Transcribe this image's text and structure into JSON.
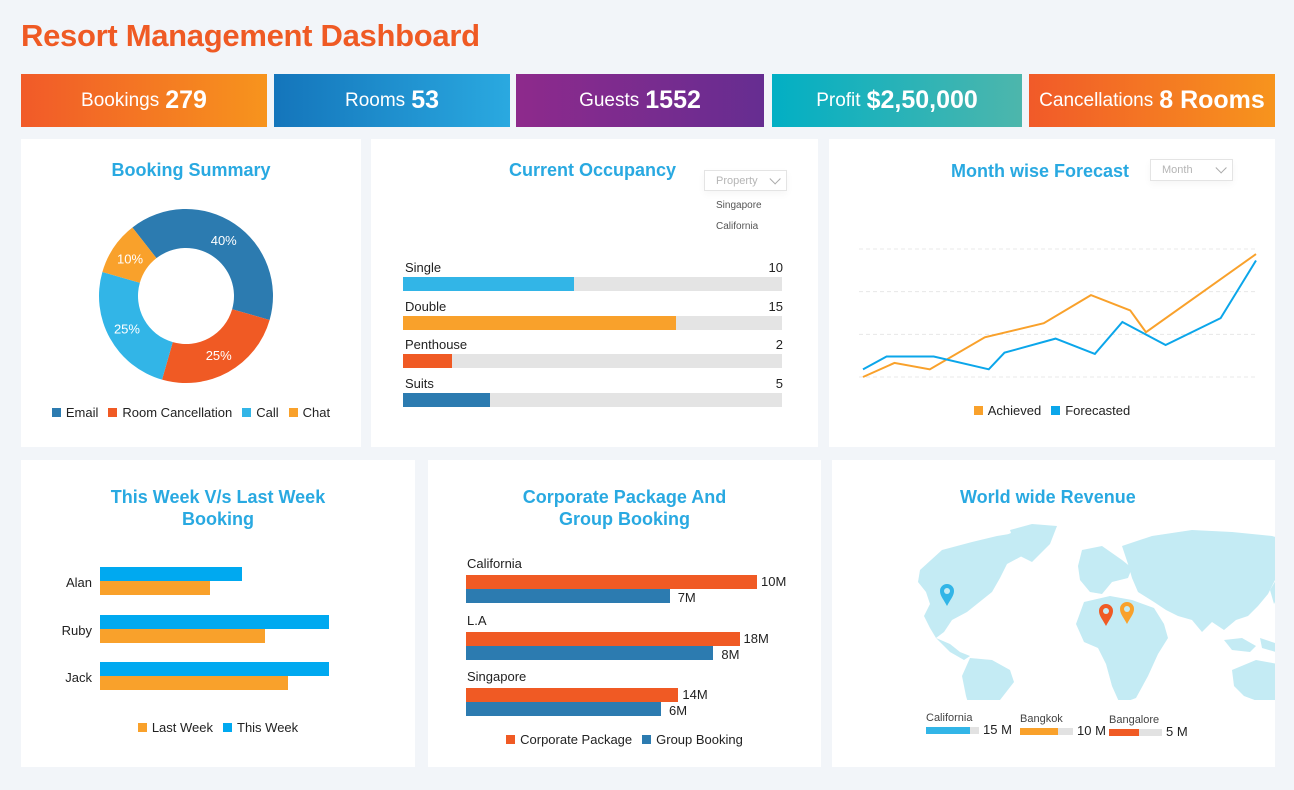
{
  "header": {
    "title": "Resort Management Dashboard"
  },
  "kpis": [
    {
      "label": "Bookings",
      "value": "279"
    },
    {
      "label": "Rooms",
      "value": "53"
    },
    {
      "label": "Guests",
      "value": "1552"
    },
    {
      "label": "Profit",
      "value": "$2,50,000"
    },
    {
      "label": "Cancellations",
      "value": "8 Rooms"
    }
  ],
  "colors": {
    "accent_title": "#ef5a24",
    "panel_title": "#29a9e1",
    "email": "#2c7bb0",
    "room_cancellation": "#f05a24",
    "call": "#32b5e7",
    "chat": "#f9a12b",
    "achieved": "#f9a12b",
    "forecasted": "#0ba6ea",
    "last_week": "#f9a12b",
    "this_week": "#00a9f0",
    "corporate": "#f05a24",
    "group": "#2c7bb0"
  },
  "booking_summary": {
    "title": "Booking Summary"
  },
  "occupancy": {
    "title": "Current Occupancy",
    "dropdown": {
      "placeholder": "Property",
      "options": [
        "Singapore",
        "California"
      ]
    }
  },
  "forecast": {
    "title": "Month wise Forecast",
    "dropdown": {
      "placeholder": "Month"
    }
  },
  "week": {
    "title_line1": "This Week V/s Last Week",
    "title_line2": "Booking"
  },
  "corporate": {
    "title_line1": "Corporate Package And",
    "title_line2": "Group Booking"
  },
  "revenue": {
    "title": "World wide Revenue",
    "items": [
      {
        "name": "California",
        "value": "15 M",
        "fill": 0.83,
        "color": "#32b5e7"
      },
      {
        "name": "Bangkok",
        "value": "10 M",
        "fill": 0.72,
        "color": "#f9a12b"
      },
      {
        "name": "Bangalore",
        "value": "5 M",
        "fill": 0.57,
        "color": "#f05a24"
      }
    ],
    "pins": [
      {
        "name": "California",
        "color": "#32b5e7"
      },
      {
        "name": "Bangalore",
        "color": "#f05a24"
      },
      {
        "name": "Bangkok",
        "color": "#f9a12b"
      }
    ]
  },
  "chart_data": [
    {
      "id": "booking-summary",
      "type": "pie",
      "title": "Booking Summary",
      "categories": [
        "Email",
        "Room Cancellation",
        "Call",
        "Chat"
      ],
      "values": [
        40,
        25,
        25,
        10
      ],
      "labels": [
        "40%",
        "25%",
        "25%",
        "10%"
      ],
      "donut": true,
      "legend": "bottom"
    },
    {
      "id": "current-occupancy",
      "type": "bar",
      "orientation": "horizontal",
      "title": "Current Occupancy",
      "categories": [
        "Single",
        "Double",
        "Penthouse",
        "Suits"
      ],
      "values": [
        10,
        15,
        2,
        5
      ],
      "fill_fraction": [
        0.45,
        0.72,
        0.13,
        0.23
      ],
      "colors": [
        "#32b5e7",
        "#f9a12b",
        "#f05a24",
        "#2c7bb0"
      ]
    },
    {
      "id": "month-forecast",
      "type": "line",
      "title": "Month wise Forecast",
      "x": [
        1,
        2,
        3,
        4,
        5,
        6,
        7,
        8,
        9,
        10,
        11,
        12
      ],
      "series": [
        {
          "name": "Achieved",
          "values": [
            0.0,
            1.1,
            0.6,
            3.1,
            4.2,
            6.4,
            5.2,
            3.5,
            null,
            null,
            null,
            9.6
          ]
        },
        {
          "name": "Forecasted",
          "values": [
            0.6,
            1.6,
            1.6,
            0.6,
            1.9,
            3.0,
            1.8,
            4.3,
            2.5,
            null,
            4.6,
            9.1
          ]
        }
      ],
      "points": {
        "Achieved": [
          [
            0,
            0.0
          ],
          [
            0.08,
            1.1
          ],
          [
            0.17,
            0.6
          ],
          [
            0.31,
            3.1
          ],
          [
            0.46,
            4.2
          ],
          [
            0.58,
            6.4
          ],
          [
            0.68,
            5.2
          ],
          [
            0.72,
            3.5
          ],
          [
            1.0,
            9.6
          ]
        ],
        "Forecasted": [
          [
            0,
            0.6
          ],
          [
            0.06,
            1.6
          ],
          [
            0.18,
            1.6
          ],
          [
            0.32,
            0.6
          ],
          [
            0.36,
            1.9
          ],
          [
            0.49,
            3.0
          ],
          [
            0.59,
            1.8
          ],
          [
            0.66,
            4.3
          ],
          [
            0.77,
            2.5
          ],
          [
            0.91,
            4.6
          ],
          [
            1.0,
            9.1
          ]
        ]
      },
      "ylim": [
        0,
        10
      ],
      "grid": true,
      "legend": "bottom"
    },
    {
      "id": "week-booking",
      "type": "bar",
      "orientation": "horizontal",
      "title": "This Week V/s Last Week Booking",
      "categories": [
        "Alan",
        "Ruby",
        "Jack"
      ],
      "series": [
        {
          "name": "This Week",
          "values": [
            62,
            100,
            100
          ]
        },
        {
          "name": "Last Week",
          "values": [
            48,
            72,
            82
          ]
        }
      ],
      "legend_order": [
        "Last Week",
        "This Week"
      ],
      "xlim": [
        0,
        100
      ],
      "legend": "bottom"
    },
    {
      "id": "corporate-group",
      "type": "bar",
      "orientation": "horizontal",
      "title": "Corporate Package And Group Booking",
      "categories": [
        "California",
        "L.A",
        "Singapore"
      ],
      "series": [
        {
          "name": "Corporate Package",
          "values": [
            10,
            18,
            14
          ],
          "labels": [
            "10M",
            "18M",
            "14M"
          ],
          "fill_fraction": [
            1.0,
            0.94,
            0.73
          ]
        },
        {
          "name": "Group Booking",
          "values": [
            7,
            8,
            6
          ],
          "labels": [
            "7M",
            "8M",
            "6M"
          ],
          "fill_fraction": [
            0.7,
            0.85,
            0.67
          ]
        }
      ],
      "legend": "bottom"
    }
  ]
}
